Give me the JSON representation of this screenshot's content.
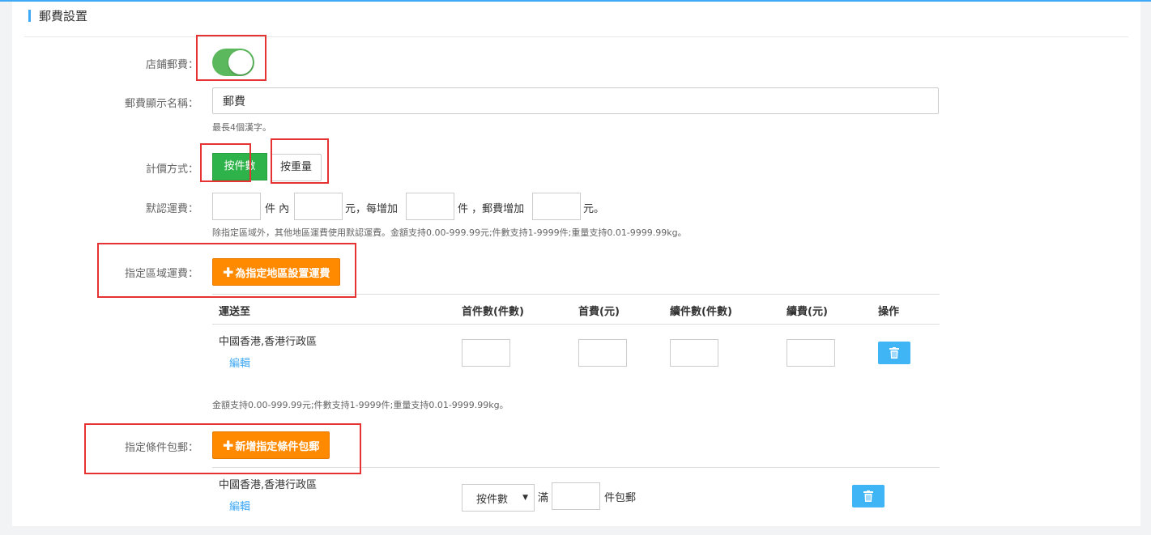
{
  "section": {
    "title": "郵費設置"
  },
  "store_postage": {
    "label": "店鋪郵費：",
    "enabled": true
  },
  "display_name": {
    "label": "郵費顯示名稱：",
    "value": "郵費",
    "hint": "最長4個漢字。"
  },
  "pricing": {
    "label": "計價方式：",
    "options": [
      "按件數",
      "按重量"
    ],
    "selected": "按件數"
  },
  "default_fee": {
    "label": "默認運費：",
    "unit_pieces_within": "件 內",
    "unit_yuan_each_add": "元，每增加",
    "unit_pieces_postage_add": "件 ，郵費增加",
    "unit_yuan_end": "元。",
    "hint": "除指定區域外，其他地區運費使用默認運費。金額支持0.00-999.99元;件數支持1-9999件;重量支持0.01-9999.99kg。"
  },
  "region_fee": {
    "label": "指定區域運費：",
    "button": "為指定地區設置運費",
    "columns": [
      "運送至",
      "首件數(件數)",
      "首費(元)",
      "續件數(件數)",
      "續費(元)",
      "操作"
    ],
    "rows": [
      {
        "destination": "中國香港,香港行政區",
        "edit": "編輯"
      }
    ],
    "hint": "金額支持0.00-999.99元;件數支持1-9999件;重量支持0.01-9999.99kg。"
  },
  "free_shipping": {
    "label": "指定條件包郵：",
    "button": "新增指定條件包郵",
    "rows": [
      {
        "destination": "中國香港,香港行政區",
        "edit": "編輯",
        "condition_select": "按件數",
        "prefix": "滿",
        "suffix": "件包郵"
      }
    ]
  },
  "colors": {
    "accent_blue": "#3fa9f5",
    "toggle_green": "#5cb85c",
    "button_green": "#2eb34a",
    "button_orange": "#ff8a00",
    "annotation_red": "#e53333"
  },
  "icons": {
    "add": "plus-icon",
    "delete": "trash-icon",
    "dropdown": "caret-down-icon"
  }
}
